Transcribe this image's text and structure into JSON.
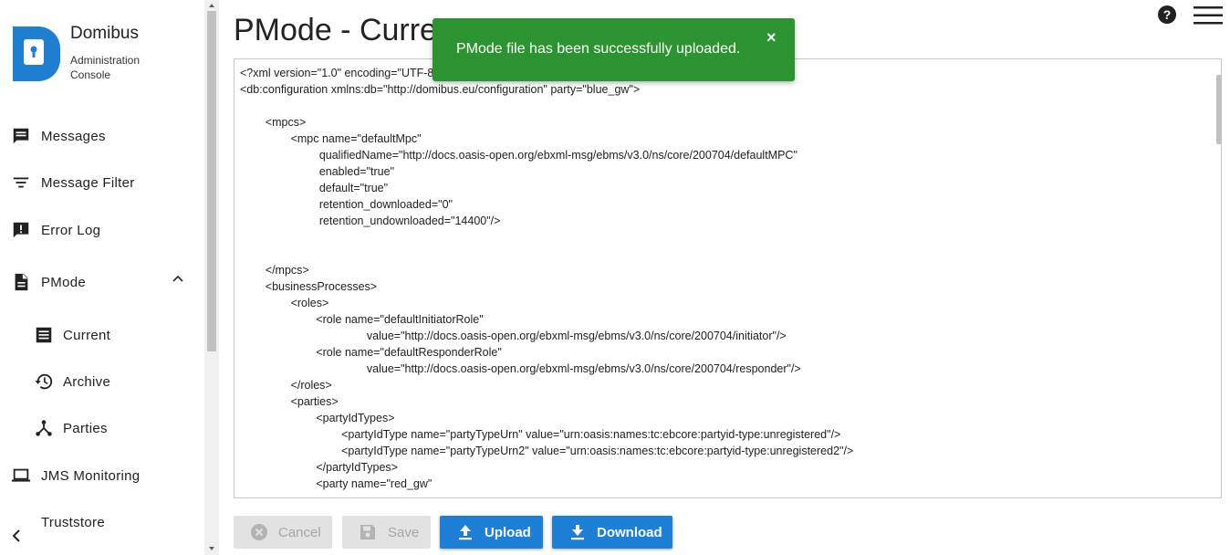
{
  "brand": {
    "title": "Domibus",
    "subtitle": "Administration Console"
  },
  "sidebar": {
    "items": [
      {
        "label": "Messages",
        "icon": "message-icon"
      },
      {
        "label": "Message Filter",
        "icon": "filter-icon"
      },
      {
        "label": "Error Log",
        "icon": "error-icon"
      },
      {
        "label": "PMode",
        "icon": "document-icon",
        "expanded": true
      },
      {
        "label": "Current",
        "icon": "list-icon"
      },
      {
        "label": "Archive",
        "icon": "history-icon"
      },
      {
        "label": "Parties",
        "icon": "parties-icon"
      },
      {
        "label": "JMS Monitoring",
        "icon": "laptop-icon"
      },
      {
        "label": "Truststore",
        "icon": "none"
      }
    ]
  },
  "page": {
    "title": "PMode - Current"
  },
  "toast": {
    "message": "PMode file has been successfully uploaded.",
    "close": "×"
  },
  "editor": {
    "content": "<?xml version=\"1.0\" encoding=\"UTF-8\"?>\n<db:configuration xmlns:db=\"http://domibus.eu/configuration\" party=\"blue_gw\">\n\n        <mpcs>\n                <mpc name=\"defaultMpc\"\n                         qualifiedName=\"http://docs.oasis-open.org/ebxml-msg/ebms/v3.0/ns/core/200704/defaultMPC\"\n                         enabled=\"true\"\n                         default=\"true\"\n                         retention_downloaded=\"0\"\n                         retention_undownloaded=\"14400\"/>\n\n\n        </mpcs>\n        <businessProcesses>\n                <roles>\n                        <role name=\"defaultInitiatorRole\"\n                                        value=\"http://docs.oasis-open.org/ebxml-msg/ebms/v3.0/ns/core/200704/initiator\"/>\n                        <role name=\"defaultResponderRole\"\n                                        value=\"http://docs.oasis-open.org/ebxml-msg/ebms/v3.0/ns/core/200704/responder\"/>\n                </roles>\n                <parties>\n                        <partyIdTypes>\n                                <partyIdType name=\"partyTypeUrn\" value=\"urn:oasis:names:tc:ebcore:partyid-type:unregistered\"/>\n                                <partyIdType name=\"partyTypeUrn2\" value=\"urn:oasis:names:tc:ebcore:partyid-type:unregistered2\"/>\n                        </partyIdTypes>\n                        <party name=\"red_gw\""
  },
  "buttons": {
    "cancel": "Cancel",
    "save": "Save",
    "upload": "Upload",
    "download": "Download"
  },
  "colors": {
    "toast": "#2b9430",
    "primary": "#1d7fd6",
    "brand": "#1f7fd0"
  }
}
